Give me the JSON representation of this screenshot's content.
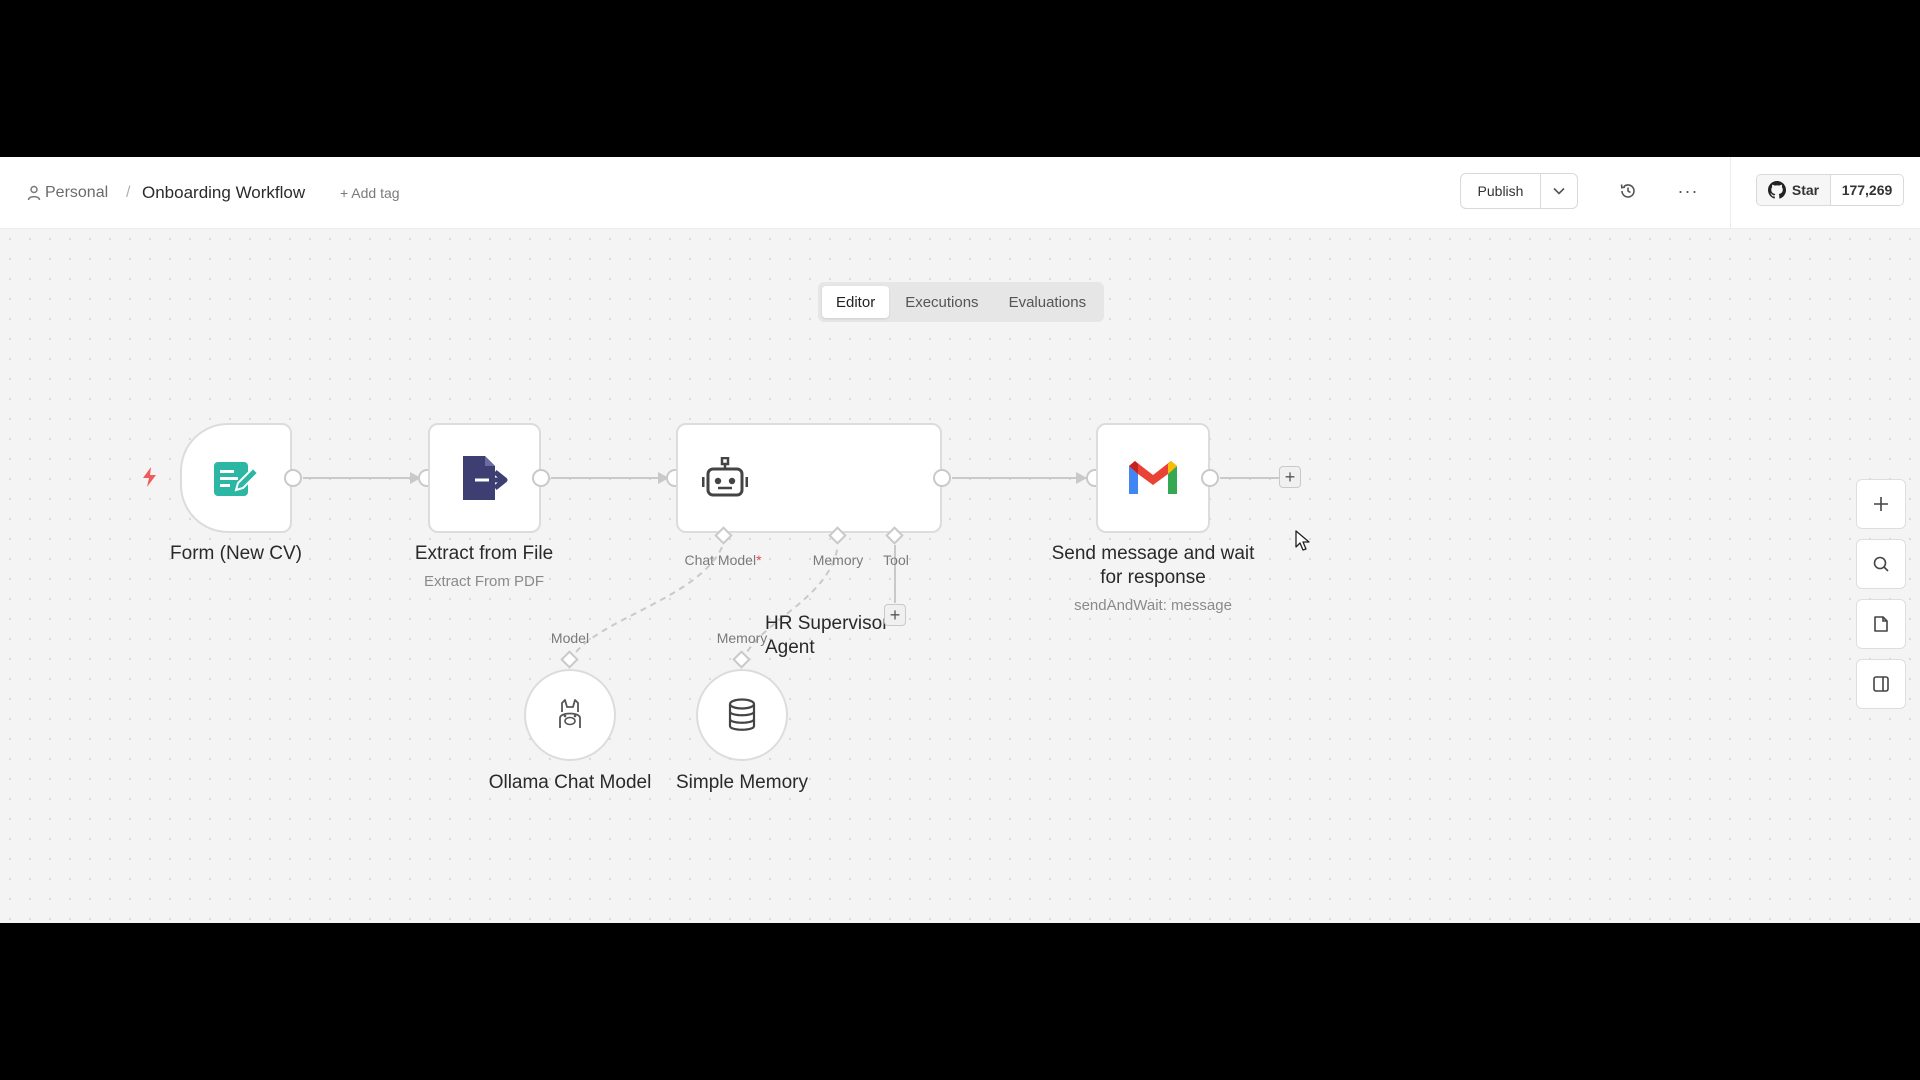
{
  "breadcrumb": {
    "project": "Personal",
    "separator": "/",
    "workflow": "Onboarding Workflow"
  },
  "header": {
    "add_tag": "+ Add tag",
    "publish": "Publish",
    "more": "···",
    "github_star": "Star",
    "github_count": "177,269"
  },
  "tabs": [
    "Editor",
    "Executions",
    "Evaluations"
  ],
  "active_tab": "Editor",
  "nodes": {
    "form": {
      "label": "Form (New CV)"
    },
    "extract": {
      "label": "Extract from File",
      "subtitle": "Extract From PDF"
    },
    "agent": {
      "label": "HR Supervisor Agent",
      "slots": {
        "chat_model": "Chat Model",
        "required_marker": "*",
        "memory": "Memory",
        "tool": "Tool"
      }
    },
    "gmail": {
      "label": "Send message and wait for response",
      "subtitle": "sendAndWait: message"
    },
    "ollama": {
      "label": "Ollama Chat Model",
      "slot": "Model"
    },
    "memory": {
      "label": "Simple Memory",
      "slot": "Memory"
    }
  },
  "add_symbol": "+",
  "icons": {
    "trigger": "lightning-icon",
    "form": "form-edit-icon",
    "extract": "file-export-icon",
    "agent": "robot-icon",
    "gmail": "gmail-icon",
    "ollama": "llama-icon",
    "memory": "database-icon",
    "zoom": "plus-icon",
    "search": "search-icon",
    "sticky": "note-icon",
    "panel": "panel-icon"
  },
  "colors": {
    "canvas": "#f4f4f4",
    "form_icon": "#2bb7a3",
    "extract_icon": "#3d3f73",
    "trigger": "#ef5b5b",
    "gmail_red": "#ea4335",
    "gmail_blue": "#4285f4",
    "gmail_green": "#34a853",
    "gmail_yellow": "#fbbc04"
  }
}
